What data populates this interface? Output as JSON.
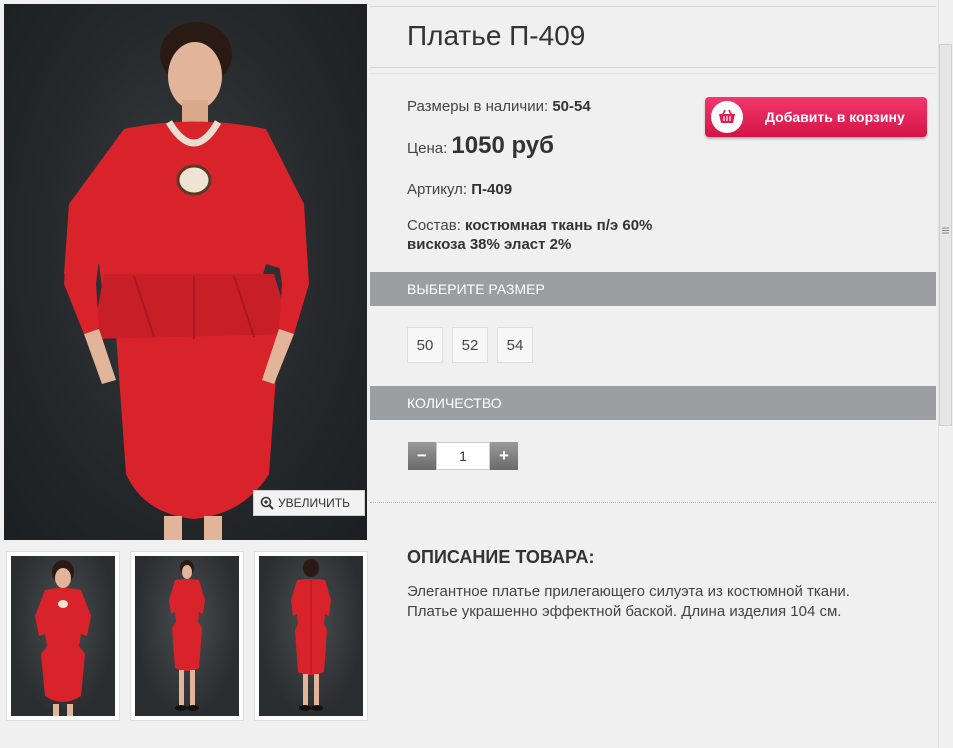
{
  "product": {
    "title": "Платье П-409",
    "sizes_label": "Размеры в наличии:",
    "sizes_value": "50-54",
    "price_label": "Цена:",
    "price_value": "1050 руб",
    "sku_label": "Артикул:",
    "sku_value": "П-409",
    "composition_label": "Состав:",
    "composition_value_1": "костюмная ткань п/э 60%",
    "composition_value_2": "вискоза 38% эласт 2%"
  },
  "cart_button": {
    "label": "Добавить в корзину",
    "icon": "basket-icon"
  },
  "gallery": {
    "zoom_label": "УВЕЛИЧИТЬ",
    "zoom_icon": "magnifier-plus-icon"
  },
  "size_section": {
    "title": "ВЫБЕРИТЕ РАЗМЕР",
    "options": [
      "50",
      "52",
      "54"
    ]
  },
  "quantity_section": {
    "title": "КОЛИЧЕСТВО",
    "minus": "−",
    "value": "1",
    "plus": "+"
  },
  "description": {
    "title": "ОПИСАНИЕ ТОВАРА:",
    "line_1": "Элегантное платье прилегающего силуэта из костюмной ткани.",
    "line_2": "Платье украшенно эффектной баской. Длина изделия 104 см."
  },
  "colors": {
    "accent": "#e01e52",
    "bar": "#9c9fa2",
    "dress": "#d8232a"
  }
}
